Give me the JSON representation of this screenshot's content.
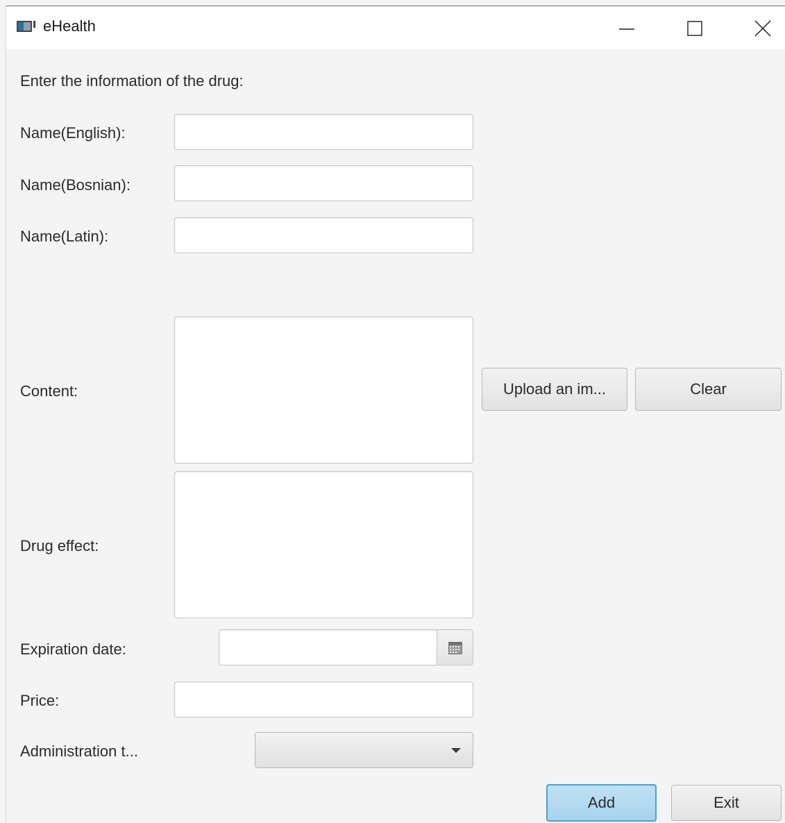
{
  "window": {
    "title": "eHealth"
  },
  "form": {
    "heading": "Enter the information of the drug:",
    "name_english_label": "Name(English):",
    "name_english_value": "",
    "name_bosnian_label": "Name(Bosnian):",
    "name_bosnian_value": "",
    "name_latin_label": "Name(Latin):",
    "name_latin_value": "",
    "content_label": "Content:",
    "drug_effect_label": "Drug effect:",
    "expiration_label": "Expiration date:",
    "expiration_value": "",
    "price_label": "Price:",
    "price_value": "",
    "administration_label": "Administration t...",
    "administration_selected": ""
  },
  "buttons": {
    "upload": "Upload an im...",
    "clear": "Clear",
    "add": "Add",
    "exit": "Exit"
  },
  "icons": {
    "app": "app-window-icon",
    "minimize": "minimize-icon",
    "maximize": "maximize-icon",
    "close": "close-icon",
    "calendar": "calendar-icon",
    "dropdown": "chevron-down-icon"
  }
}
